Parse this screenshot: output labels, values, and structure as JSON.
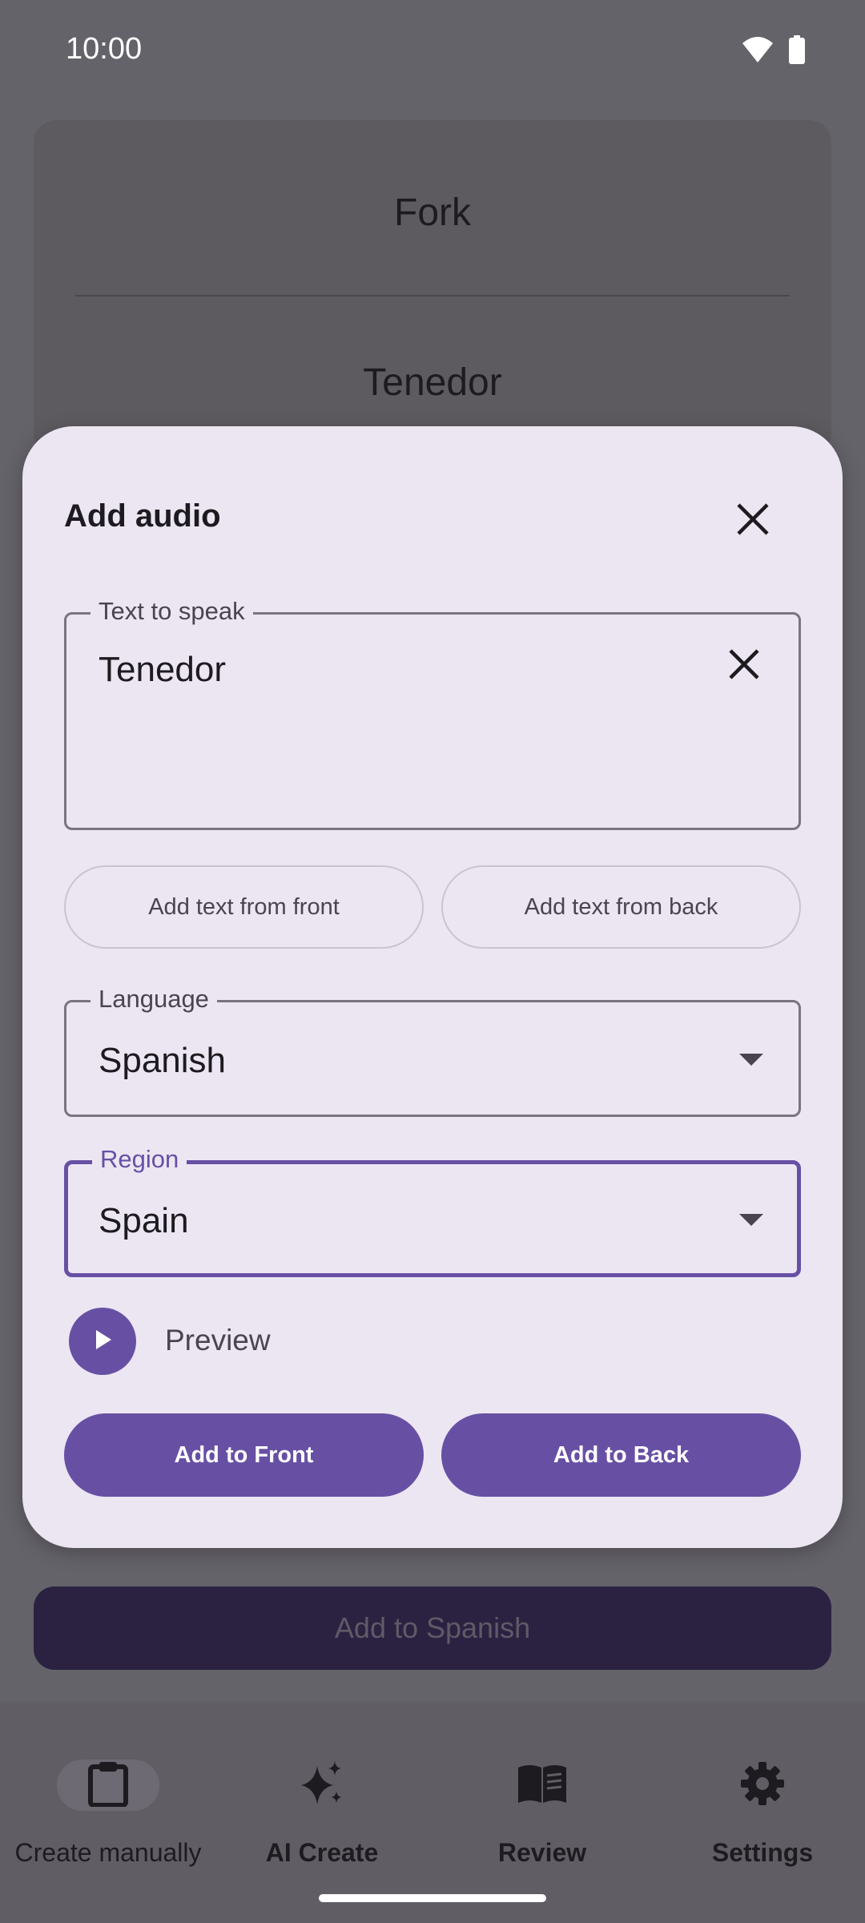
{
  "status_bar": {
    "time": "10:00",
    "icons": [
      "wifi-icon",
      "battery-icon"
    ]
  },
  "background_card": {
    "front": "Fork",
    "back": "Tenedor"
  },
  "dialog": {
    "title": "Add audio",
    "text_field": {
      "label": "Text to speak",
      "value": "Tenedor"
    },
    "add_from_front_label": "Add text from front",
    "add_from_back_label": "Add text from back",
    "language": {
      "label": "Language",
      "value": "Spanish"
    },
    "region": {
      "label": "Region",
      "value": "Spain"
    },
    "preview_label": "Preview",
    "add_to_front_label": "Add to Front",
    "add_to_back_label": "Add to Back"
  },
  "main_action_label": "Add to Spanish",
  "bottom_nav": {
    "items": [
      {
        "label": "Create manually",
        "icon": "clipboard-icon",
        "active": true
      },
      {
        "label": "AI Create",
        "icon": "sparkle-icon",
        "active": false
      },
      {
        "label": "Review",
        "icon": "book-icon",
        "active": false
      },
      {
        "label": "Settings",
        "icon": "gear-icon",
        "active": false
      }
    ]
  },
  "colors": {
    "primary": "#6750a4",
    "dialog_surface": "#ece6f3",
    "scrim_background": "#65636a"
  }
}
